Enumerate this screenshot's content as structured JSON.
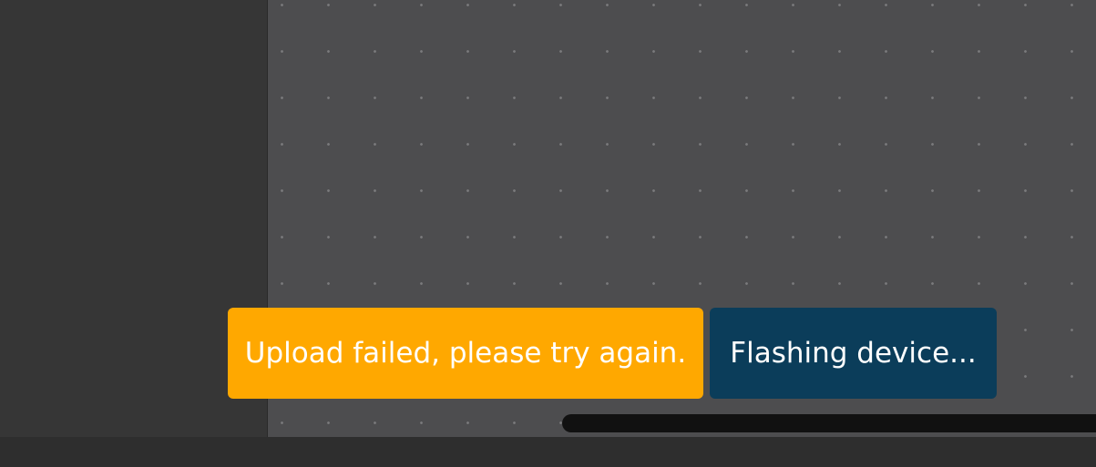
{
  "notifications": [
    {
      "message": "Upload failed, please try again.",
      "type": "warning",
      "color": "#ffa800"
    },
    {
      "message": "Flashing device...",
      "type": "info",
      "color": "#0b3d5a"
    }
  ],
  "theme": {
    "sidebar_background": "#363636",
    "workspace_background": "#4d4d4f",
    "workspace_grid_dots": "#7a7a7c",
    "bottom_bar_background": "#2e2e2e",
    "scrollbar_color": "#111111"
  }
}
